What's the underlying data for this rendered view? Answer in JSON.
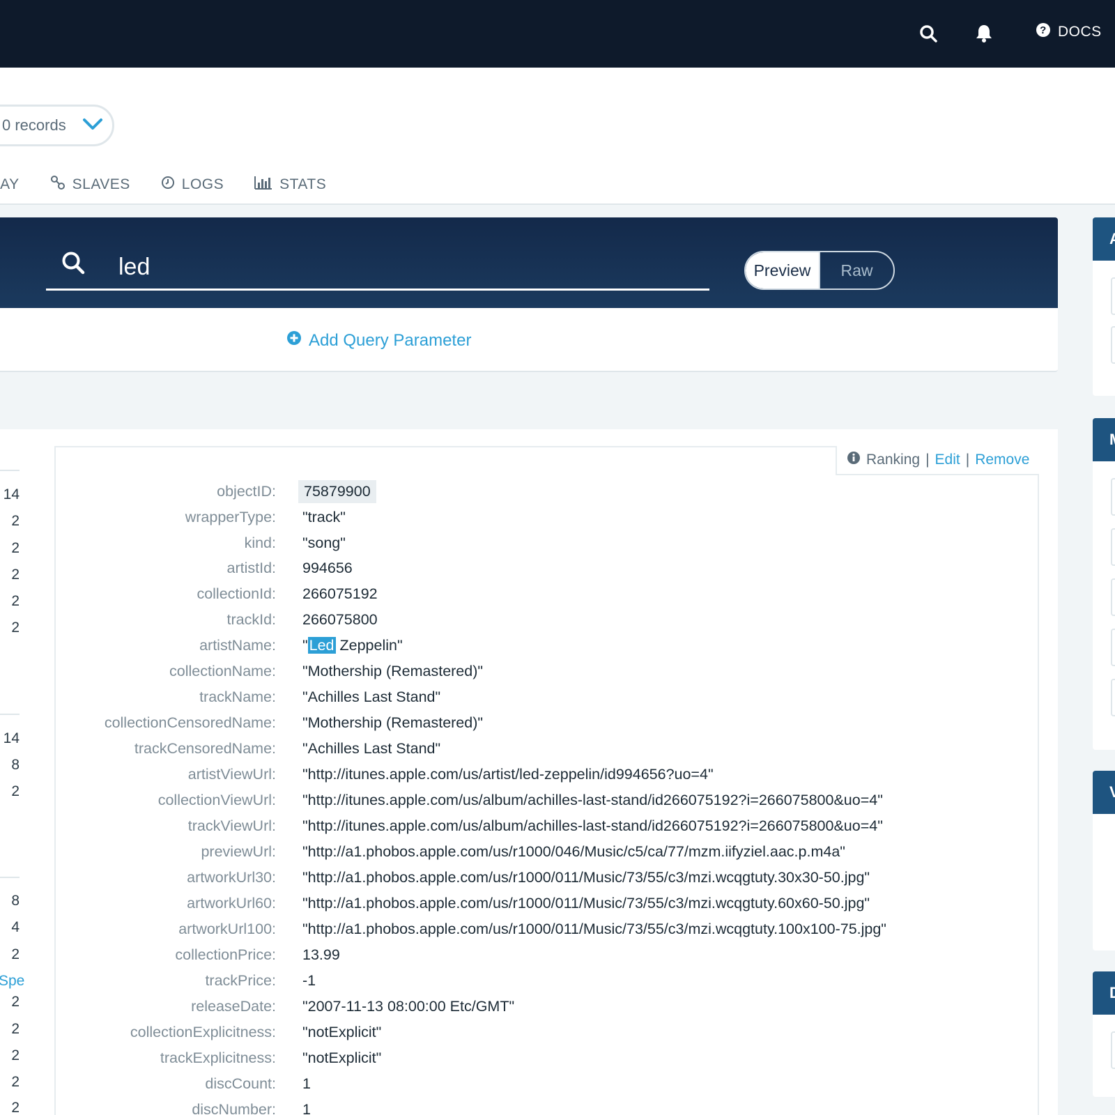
{
  "topbar": {
    "docs_label": "DOCS",
    "icons": [
      "search-icon",
      "bell-icon",
      "help-icon"
    ]
  },
  "header": {
    "records_label": "0 records",
    "tabs": [
      {
        "label": "LAY",
        "icon": "none"
      },
      {
        "label": "SLAVES",
        "icon": "link-icon"
      },
      {
        "label": "LOGS",
        "icon": "clock-icon"
      },
      {
        "label": "STATS",
        "icon": "bar-chart-icon"
      }
    ]
  },
  "search": {
    "query": "led",
    "preview_label": "Preview",
    "raw_label": "Raw",
    "add_param_label": "Add Query Parameter"
  },
  "right_panels": {
    "labels": [
      "A",
      "M",
      "V",
      "D"
    ]
  },
  "left_column": {
    "numbers": [
      "14",
      "2",
      "2",
      "2",
      "2",
      "2",
      "14",
      "8",
      "2",
      "8",
      "4",
      "2",
      "2",
      "2",
      "2",
      "2",
      "2"
    ],
    "link_text": "Spe"
  },
  "record": {
    "actions": {
      "ranking_label": "Ranking",
      "edit_label": "Edit",
      "remove_label": "Remove",
      "separator": "|"
    },
    "highlight": "Led",
    "fields": [
      {
        "key": "objectID:",
        "value": "75879900"
      },
      {
        "key": "wrapperType:",
        "value": "\"track\""
      },
      {
        "key": "kind:",
        "value": "\"song\""
      },
      {
        "key": "artistId:",
        "value": "994656"
      },
      {
        "key": "collectionId:",
        "value": "266075192"
      },
      {
        "key": "trackId:",
        "value": "266075800"
      },
      {
        "key": "artistName:",
        "value_prefix": "\"",
        "value_highlight": "Led",
        "value_suffix": " Zeppelin\""
      },
      {
        "key": "collectionName:",
        "value": "\"Mothership (Remastered)\""
      },
      {
        "key": "trackName:",
        "value": "\"Achilles Last Stand\""
      },
      {
        "key": "collectionCensoredName:",
        "value": "\"Mothership (Remastered)\""
      },
      {
        "key": "trackCensoredName:",
        "value": "\"Achilles Last Stand\""
      },
      {
        "key": "artistViewUrl:",
        "value": "\"http://itunes.apple.com/us/artist/led-zeppelin/id994656?uo=4\""
      },
      {
        "key": "collectionViewUrl:",
        "value": "\"http://itunes.apple.com/us/album/achilles-last-stand/id266075192?i=266075800&uo=4\""
      },
      {
        "key": "trackViewUrl:",
        "value": "\"http://itunes.apple.com/us/album/achilles-last-stand/id266075192?i=266075800&uo=4\""
      },
      {
        "key": "previewUrl:",
        "value": "\"http://a1.phobos.apple.com/us/r1000/046/Music/c5/ca/77/mzm.iifyziel.aac.p.m4a\""
      },
      {
        "key": "artworkUrl30:",
        "value": "\"http://a1.phobos.apple.com/us/r1000/011/Music/73/55/c3/mzi.wcqgtuty.30x30-50.jpg\""
      },
      {
        "key": "artworkUrl60:",
        "value": "\"http://a1.phobos.apple.com/us/r1000/011/Music/73/55/c3/mzi.wcqgtuty.60x60-50.jpg\""
      },
      {
        "key": "artworkUrl100:",
        "value": "\"http://a1.phobos.apple.com/us/r1000/011/Music/73/55/c3/mzi.wcqgtuty.100x100-75.jpg\""
      },
      {
        "key": "collectionPrice:",
        "value": "13.99"
      },
      {
        "key": "trackPrice:",
        "value": "-1"
      },
      {
        "key": "releaseDate:",
        "value": "\"2007-11-13 08:00:00 Etc/GMT\""
      },
      {
        "key": "collectionExplicitness:",
        "value": "\"notExplicit\""
      },
      {
        "key": "trackExplicitness:",
        "value": "\"notExplicit\""
      },
      {
        "key": "discCount:",
        "value": "1"
      },
      {
        "key": "discNumber:",
        "value": "1"
      }
    ]
  },
  "colors": {
    "topbar": "#0e1a2b",
    "search_panel": "#13294a",
    "accent": "#2c9fd6",
    "right_header": "#1e5480"
  }
}
